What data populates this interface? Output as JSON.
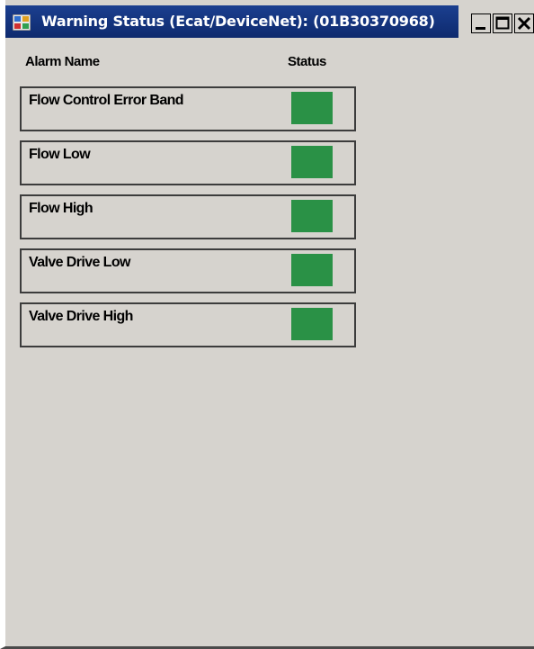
{
  "window": {
    "title": "Warning Status (Ecat/DeviceNet): (01B30370968)",
    "icon": "application-icon",
    "controls": [
      "minimize-icon",
      "maximize-icon",
      "close-icon"
    ]
  },
  "table": {
    "headers": {
      "name": "Alarm Name",
      "status": "Status"
    },
    "rows": [
      {
        "label": "Flow Control Error Band",
        "status_color": "#2a9146"
      },
      {
        "label": "Flow Low",
        "status_color": "#2a9146"
      },
      {
        "label": "Flow High",
        "status_color": "#2a9146"
      },
      {
        "label": "Valve Drive Low",
        "status_color": "#2a9146"
      },
      {
        "label": "Valve Drive High",
        "status_color": "#2a9146"
      }
    ]
  },
  "colors": {
    "titlebar": "#1b3f8f",
    "window_background": "#d6d3ce",
    "status_ok": "#2a9146"
  }
}
